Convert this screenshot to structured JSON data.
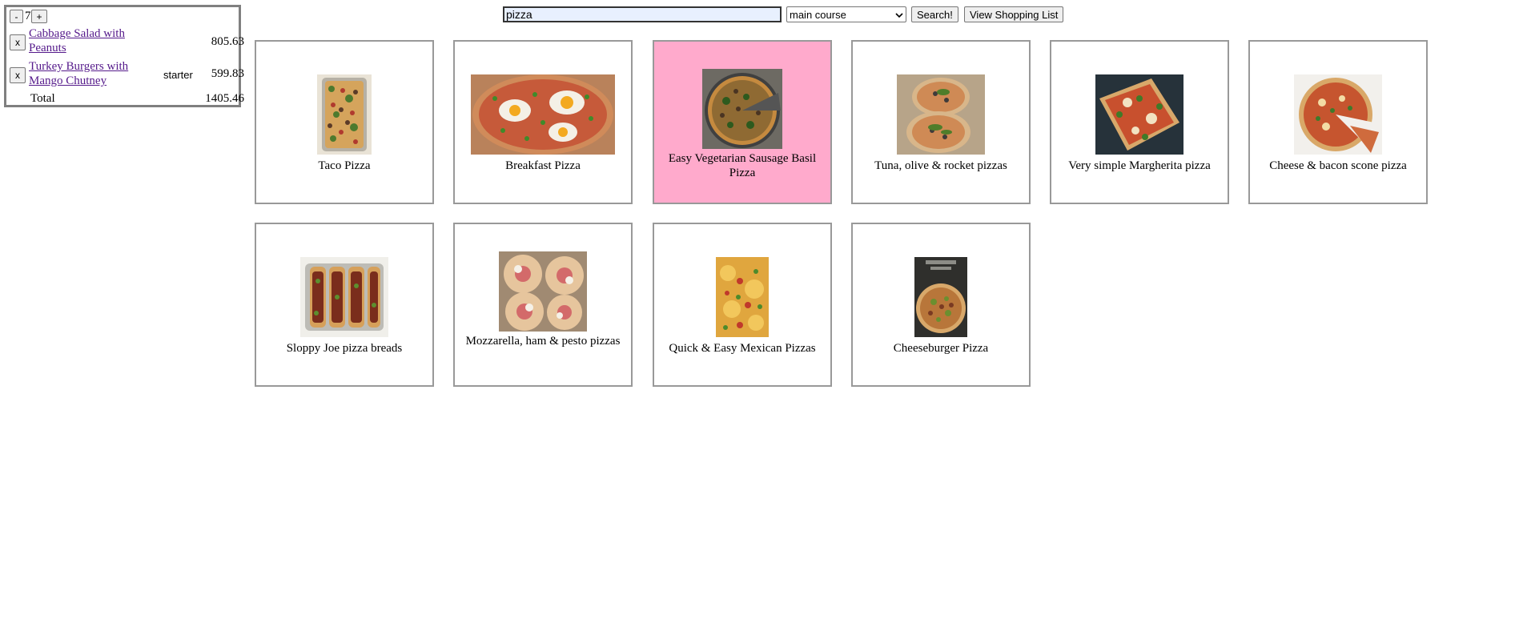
{
  "menu": {
    "minus_label": "-",
    "plus_label": "+",
    "guests": "7",
    "dishes": [
      {
        "remove_label": "x",
        "name": "Cabbage Salad with Peanuts",
        "type": "",
        "price": "805.63"
      },
      {
        "remove_label": "x",
        "name": "Turkey Burgers with Mango Chutney",
        "type": "starter",
        "price": "599.83"
      }
    ],
    "total_label": "Total",
    "total_price": "1405.46"
  },
  "search": {
    "value": "pizza",
    "course_selected": "main course",
    "search_button": "Search!",
    "shopping_button": "View Shopping List"
  },
  "results": [
    {
      "title": "Taco Pizza",
      "icon": "taco-pizza-photo"
    },
    {
      "title": "Breakfast Pizza",
      "icon": "breakfast-pizza-photo"
    },
    {
      "title": "Easy Vegetarian Sausage Basil Pizza",
      "icon": "vegetarian-pizza-photo",
      "highlighted": true
    },
    {
      "title": "Tuna, olive & rocket pizzas",
      "icon": "tuna-pizza-photo"
    },
    {
      "title": "Very simple Margherita pizza",
      "icon": "margherita-pizza-photo"
    },
    {
      "title": "Cheese & bacon scone pizza",
      "icon": "scone-pizza-photo"
    },
    {
      "title": "Sloppy Joe pizza breads",
      "icon": "sloppy-joe-photo"
    },
    {
      "title": "Mozzarella, ham & pesto pizzas",
      "icon": "mozzarella-pizza-photo"
    },
    {
      "title": "Quick & Easy Mexican Pizzas",
      "icon": "mexican-pizza-photo"
    },
    {
      "title": "Cheeseburger Pizza",
      "icon": "cheeseburger-pizza-photo"
    }
  ],
  "colors": {
    "highlight": "#ffaacc",
    "card_border": "#999999",
    "link": "#551a8b"
  }
}
